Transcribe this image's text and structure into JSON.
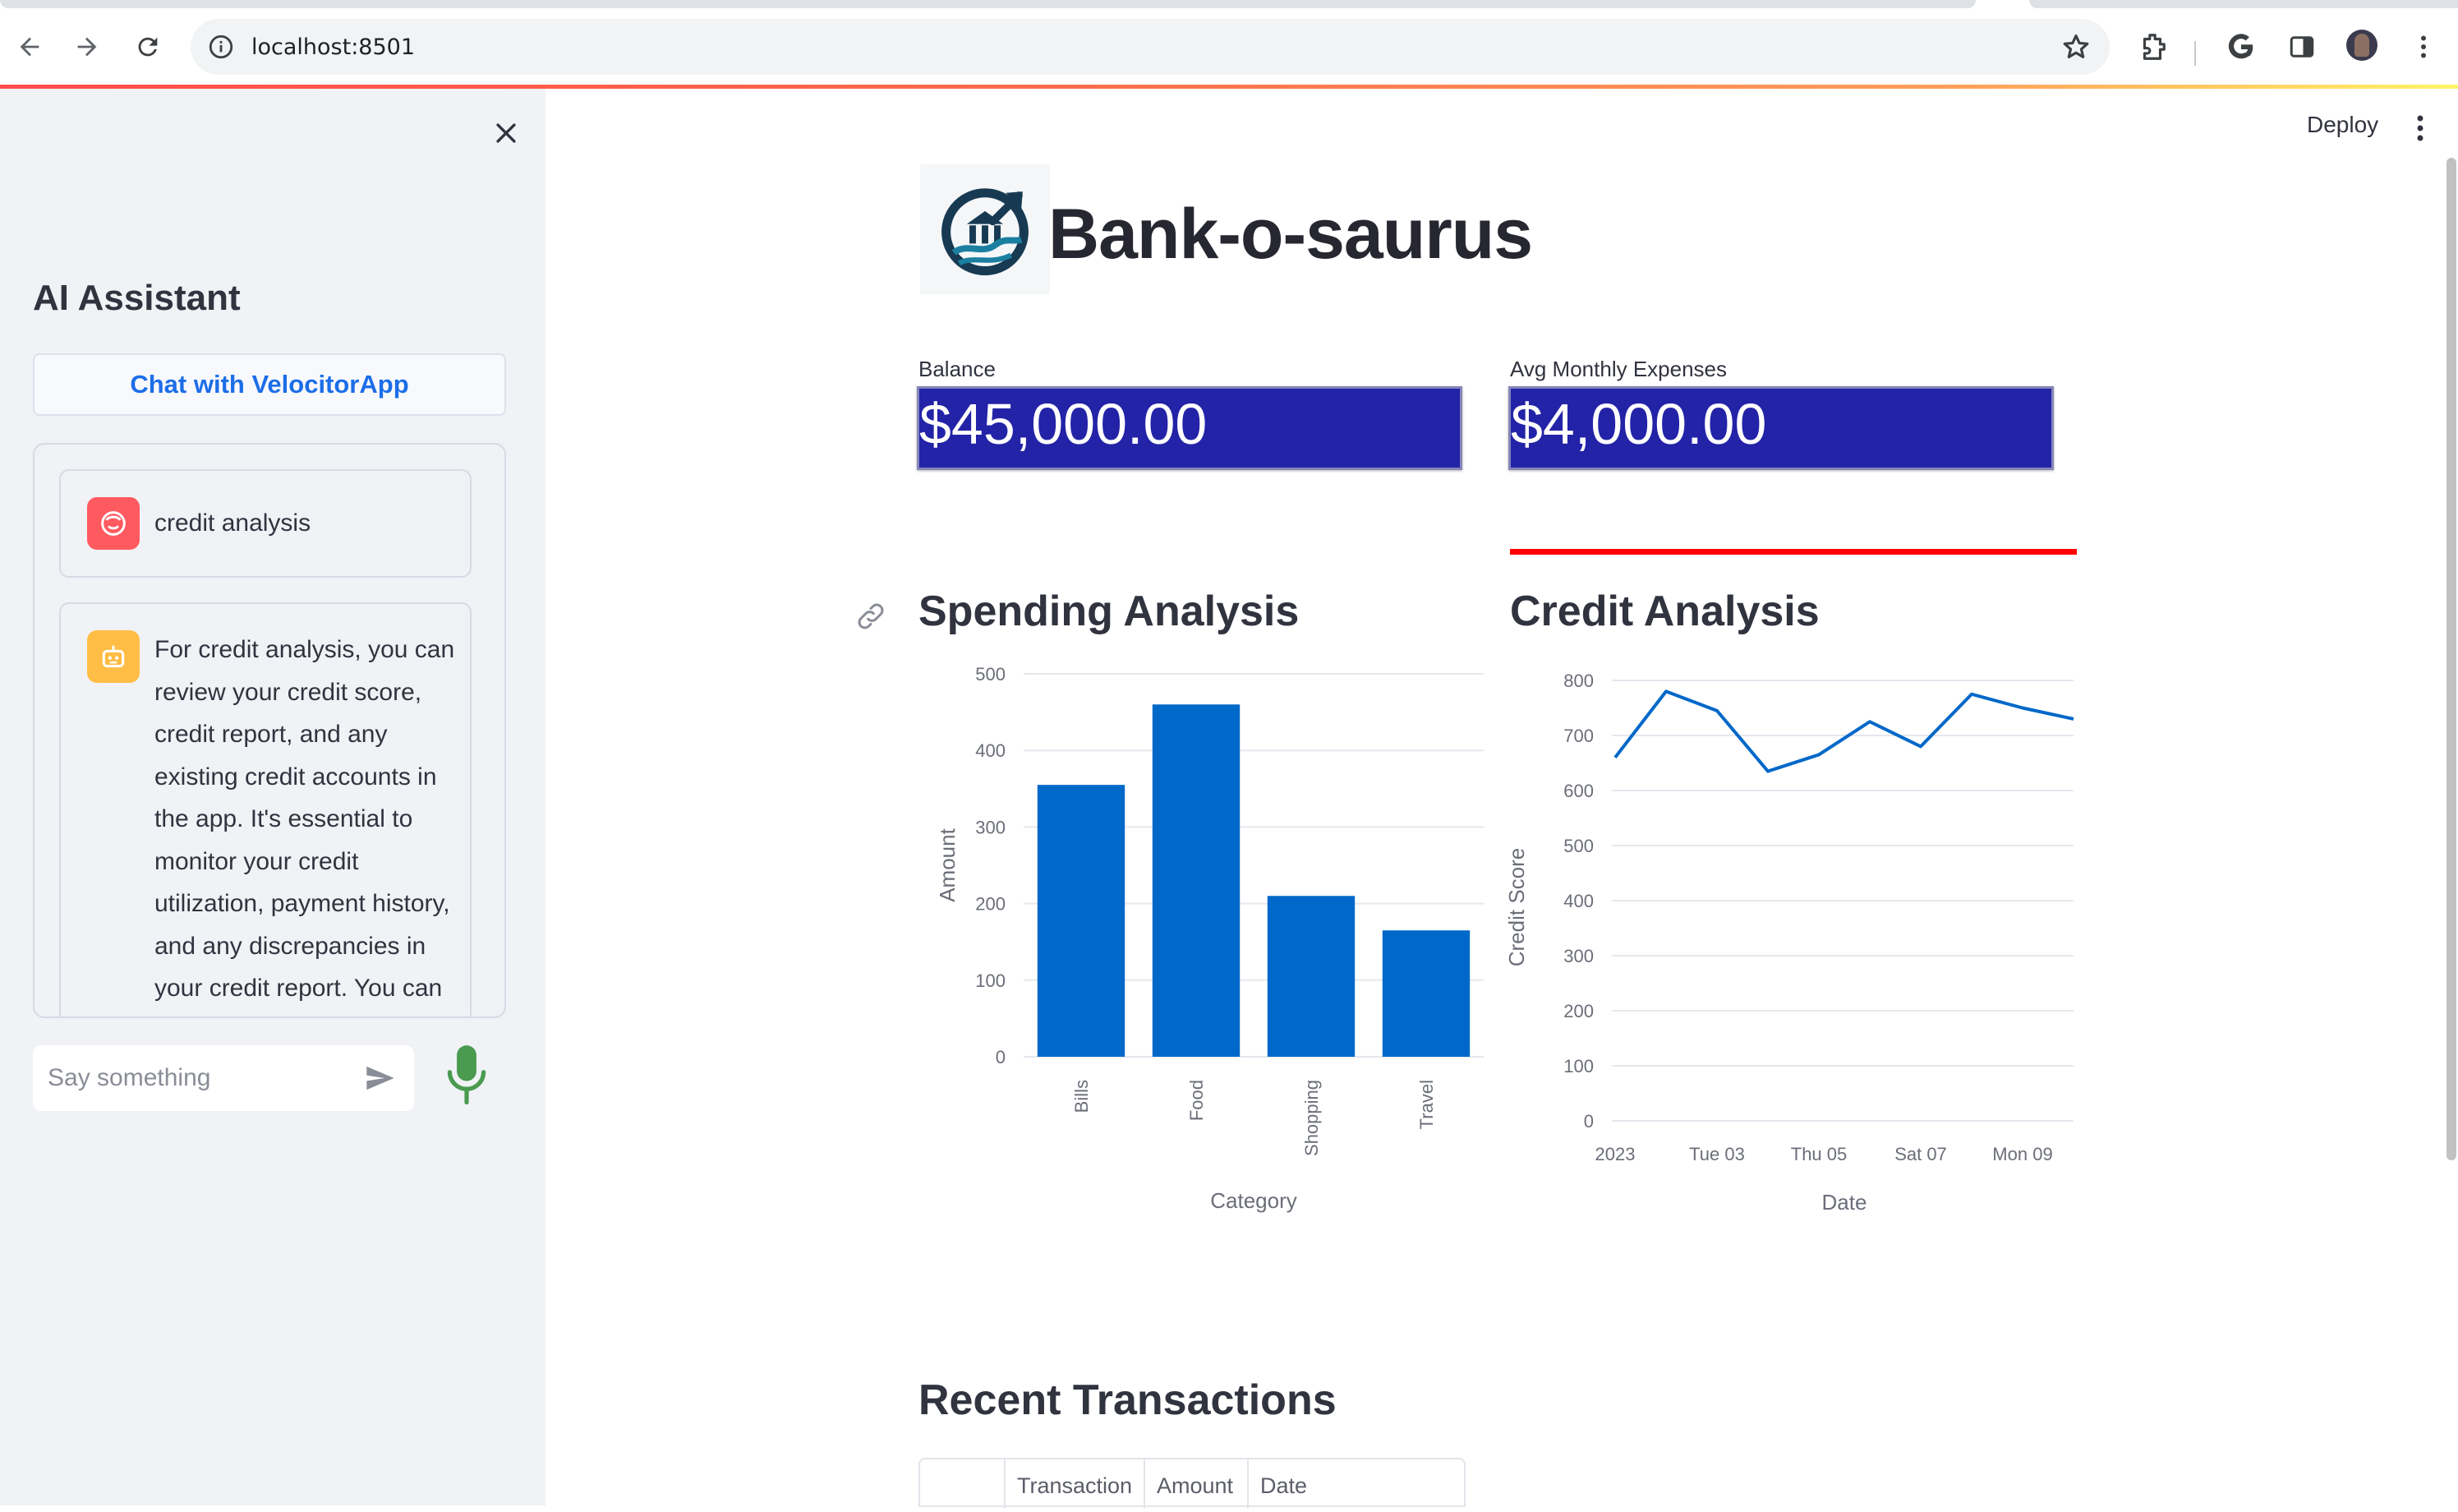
{
  "browser": {
    "url": "localhost:8501",
    "icons": [
      "back-icon",
      "forward-icon",
      "reload-icon",
      "site-info-icon",
      "bookmark-star-icon",
      "extensions-icon",
      "google-icon",
      "side-panel-icon",
      "profile-avatar",
      "browser-menu-icon"
    ]
  },
  "app_header": {
    "deploy_label": "Deploy"
  },
  "sidebar": {
    "title": "AI Assistant",
    "chat_button_label": "Chat with VelocitorApp",
    "messages": [
      {
        "role": "user",
        "text": "credit analysis"
      },
      {
        "role": "assistant",
        "text": "For credit analysis, you can\nreview your credit score,\ncredit report, and any\nexisting credit accounts in\nthe app. It's essential to\nmonitor your credit\nutilization, payment history,\nand any discrepancies in\nyour credit report. You can"
      }
    ],
    "input_placeholder": "Say something",
    "mic_color": "#4a9a4f"
  },
  "main": {
    "title": "Bank-o-saurus",
    "metrics": [
      {
        "label": "Balance",
        "value": "$45,000.00"
      },
      {
        "label": "Avg Monthly Expenses",
        "value": "$4,000.00"
      }
    ],
    "metric_bg_color": "#2323a8",
    "divider_color": "#ff0000",
    "spending_title": "Spending Analysis",
    "credit_title": "Credit Analysis",
    "transactions_title": "Recent Transactions",
    "transactions_columns": [
      "",
      "Transaction",
      "Amount",
      "Date"
    ]
  },
  "chart_data": [
    {
      "type": "bar",
      "title": "Spending Analysis",
      "categories": [
        "Bills",
        "Food",
        "Shopping",
        "Travel"
      ],
      "values": [
        355,
        460,
        210,
        165
      ],
      "xlabel": "Category",
      "ylabel": "Amount",
      "ylim": [
        0,
        500
      ],
      "yticks": [
        0,
        100,
        200,
        300,
        400,
        500
      ],
      "grid": true,
      "color": "#0068c9"
    },
    {
      "type": "line",
      "title": "Credit Analysis",
      "x": [
        "2023-01-01",
        "2023-01-02",
        "2023-01-03",
        "2023-01-04",
        "2023-01-05",
        "2023-01-06",
        "2023-01-07",
        "2023-01-08",
        "2023-01-09",
        "2023-01-10"
      ],
      "xticks": [
        "2023",
        "Tue 03",
        "Thu 05",
        "Sat 07",
        "Mon 09"
      ],
      "values": [
        660,
        780,
        745,
        635,
        665,
        725,
        680,
        775,
        750,
        730
      ],
      "xlabel": "Date",
      "ylabel": "Credit Score",
      "ylim": [
        0,
        800
      ],
      "yticks": [
        0,
        100,
        200,
        300,
        400,
        500,
        600,
        700,
        800
      ],
      "grid": true,
      "color": "#0068c9"
    }
  ]
}
